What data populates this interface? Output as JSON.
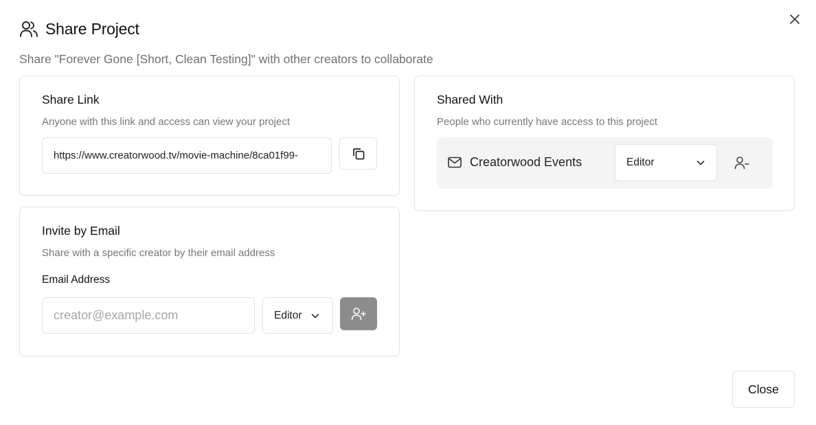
{
  "dialog": {
    "title": "Share Project",
    "subtitle": "Share \"Forever Gone [Short, Clean Testing]\" with other creators to collaborate",
    "close_label": "Close"
  },
  "share_link": {
    "title": "Share Link",
    "description": "Anyone with this link and access can view your project",
    "url": "https://www.creatorwood.tv/movie-machine/8ca01f99-"
  },
  "invite": {
    "title": "Invite by Email",
    "description": "Share with a specific creator by their email address",
    "email_label": "Email Address",
    "email_value": "",
    "email_placeholder": "creator@example.com",
    "role": "Editor"
  },
  "shared_with": {
    "title": "Shared With",
    "description": "People who currently have access to this project",
    "members": [
      {
        "name": "Creatorwood Events",
        "role": "Editor"
      }
    ]
  },
  "icons": {
    "header": "users-icon",
    "close": "x-icon",
    "copy": "copy-icon",
    "add": "user-plus-icon",
    "mail": "mail-icon",
    "remove": "user-minus-icon",
    "dropdown": "chevron-down-icon"
  },
  "colors": {
    "add_button": "#8c8c8c",
    "member_row_bg": "#f4f4f4",
    "muted_text": "#777777"
  }
}
